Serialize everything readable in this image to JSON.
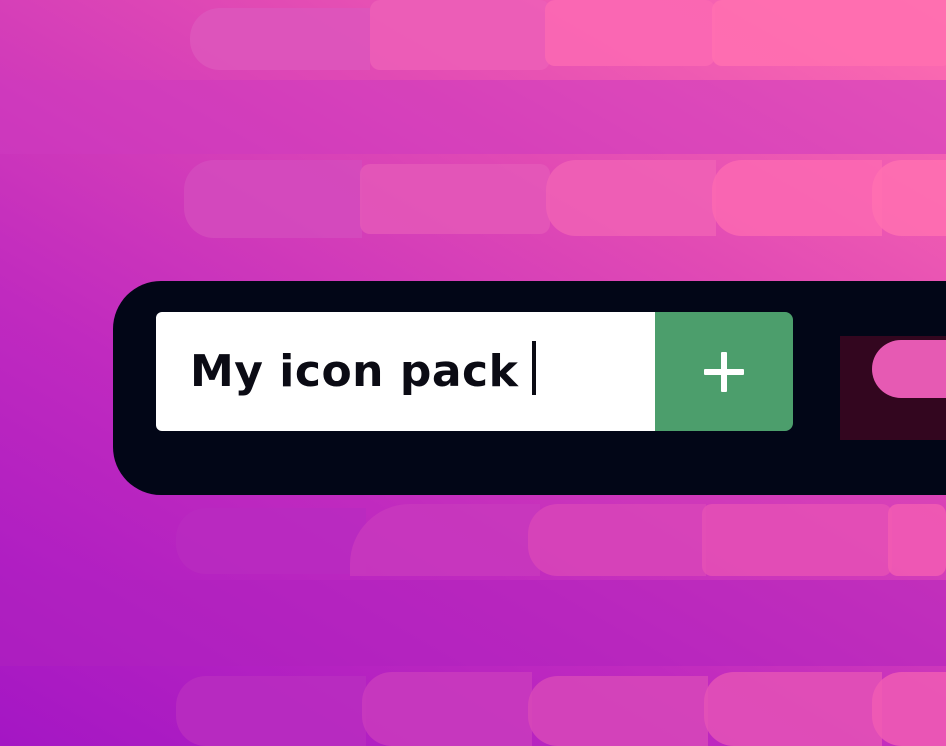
{
  "input": {
    "value": "My icon pack"
  },
  "add_button": {
    "icon": "plus-icon"
  },
  "colors": {
    "shell": "#020617",
    "button": "#4c9e6c",
    "input_bg": "#ffffff",
    "text": "#0b0b14"
  }
}
